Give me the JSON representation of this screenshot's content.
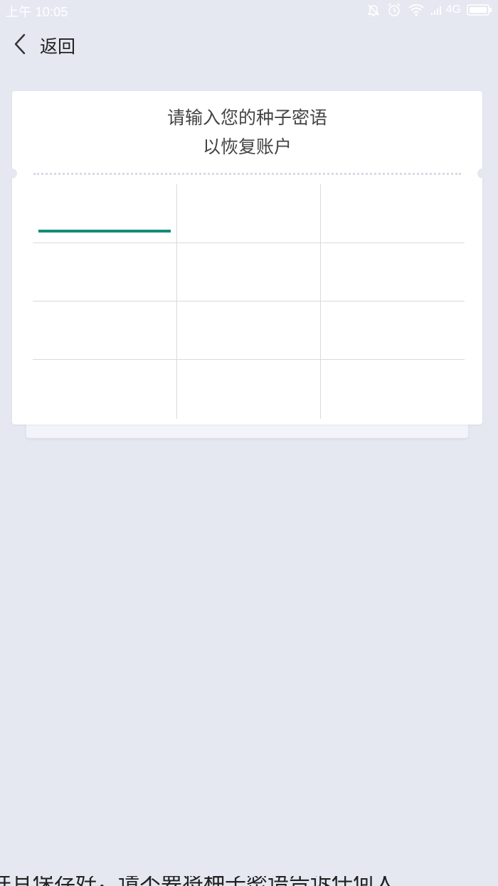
{
  "status_bar": {
    "time": "上午 10:05",
    "network": "4G",
    "icons": [
      "notification-muted-icon",
      "alarm-clock-icon",
      "wifi-icon",
      "signal-icon",
      "battery-icon"
    ]
  },
  "header": {
    "back_label": "返回",
    "back_icon": "chevron-left-icon"
  },
  "card": {
    "title_line1": "请输入您的种子密语",
    "title_line2": "以恢复账户",
    "accent_color": "#138a7a",
    "words": [
      "",
      "",
      "",
      "",
      "",
      "",
      "",
      "",
      "",
      "",
      "",
      ""
    ],
    "active_index": 0
  },
  "bottom_text": "并且保存好，请不要将种子密语告诉任何人"
}
